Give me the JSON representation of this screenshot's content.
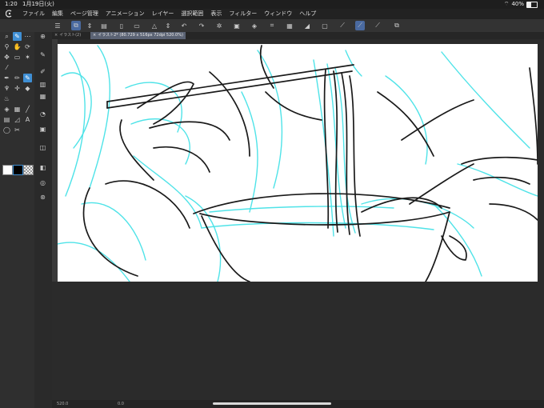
{
  "status": {
    "time": "1:20",
    "date": "1月19日(火)",
    "battery": "40%"
  },
  "menu": {
    "items": [
      "ファイル",
      "編集",
      "ページ管理",
      "アニメーション",
      "レイヤー",
      "選択範囲",
      "表示",
      "フィルター",
      "ウィンドウ",
      "ヘルプ"
    ]
  },
  "tabs": [
    {
      "label": "イラスト(2)"
    },
    {
      "label": "イラスト2* (80.729 x 516px 72dpi 520.0%)"
    }
  ],
  "bottom": {
    "zoom": "520.0",
    "angle": "0.0"
  },
  "colors": {
    "accent": "#3f8fd4",
    "sketch_cyan": "#4fe3e8",
    "line_black": "#1a1a1a",
    "main_color": "#ffffff",
    "sub_color": "#000000"
  },
  "icons": {
    "menu_toggle": "hamburger-icon",
    "undo": "undo-icon",
    "redo": "redo-icon",
    "wifi": "wifi-icon"
  }
}
